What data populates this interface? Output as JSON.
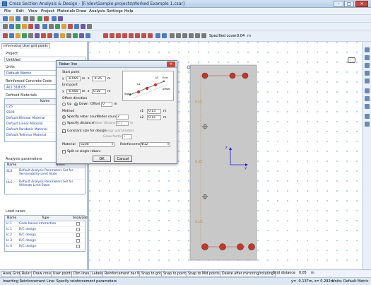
{
  "window": {
    "title": "Cross Section Analysis & Design - [F:\\dev\\Sample projects\\Worked Example 1.csar]",
    "colors": {
      "accent": "#3a7bd5",
      "rebar": "#c0392b",
      "section": "#c8c8c8",
      "grid_dot": "#3e8ed0"
    }
  },
  "menu": [
    "File",
    "Edit",
    "View",
    "Project",
    "Materials",
    "Draw",
    "Analysis",
    "Settings",
    "Help"
  ],
  "draw_toolbar": {
    "cover_label": "Specified cover:",
    "cover_value": "0.04",
    "cover_unit": "m"
  },
  "left_panel": {
    "tabs": [
      "Information",
      "User grid points"
    ],
    "project_label": "Project",
    "project_value": "Untitled",
    "units_label": "Units",
    "units_value": "Default Metric",
    "code_label": "Reinforced Concrete Code",
    "code_value": "ACI 318:05",
    "materials_label": "Defined Materials",
    "materials_header": "Name",
    "materials": [
      "C25",
      "S500",
      "Default Bilinear Material",
      "Default Linear Material",
      "Default Parabolic Material",
      "Default Tellinear Material"
    ],
    "analysis_label": "Analysis parameters",
    "analysis_headers": [
      "Name",
      "Notes"
    ],
    "analysis_rows": [
      {
        "name": "SLS",
        "notes": "Default Analysis Parameters Set for Serviceability Limit State"
      },
      {
        "name": "ULS",
        "notes": "Default Analysis Parameters Set for Ultimate Limit State"
      }
    ],
    "loads_label": "Load cases",
    "loads_headers": [
      "Name",
      "Type",
      "Analyzed"
    ],
    "loads": [
      {
        "name": "lc 1",
        "type": "Code based interaction"
      },
      {
        "name": "lc 1",
        "type": "R/C design"
      },
      {
        "name": "lc 2",
        "type": "R/C design"
      },
      {
        "name": "lc 3",
        "type": "R/C design"
      },
      {
        "name": "lc 4",
        "type": "R/C design"
      }
    ]
  },
  "dialog": {
    "title": "Rebar line",
    "start_point_label": "Start point",
    "start_y_label": "y",
    "start_y": "-0.085",
    "start_y_unit": "m",
    "start_z_label": "z",
    "start_z": "-0.26",
    "start_z_unit": "m",
    "end_point_label": "End point",
    "end_y_label": "y",
    "end_y": "-0.085",
    "end_y_unit": "m",
    "end_z_label": "z",
    "end_z": "0.26",
    "end_z_unit": "m",
    "offset_direction_label": "Offset direction",
    "up_label": "Up",
    "down_label": "Down",
    "offset_label": "Offset",
    "offset_value": "0",
    "offset_unit": "m",
    "method_label": "Method",
    "specify_count_label": "Specify rebar count",
    "rebar_count_label": "Rebar count",
    "rebar_count": "2",
    "specify_distance_label": "Specify distance",
    "rebar_distance_label": "Rebar distance",
    "rebar_distance": "0.1",
    "rebar_distance_unit": "m",
    "s1_label": "s1",
    "s1": "0.15",
    "s1_unit": "m",
    "s2_label": "s2",
    "s2": "0.15",
    "s2_unit": "m",
    "constant_size_label": "Constant size for design",
    "design_params_label": "Design parameters",
    "grow_factor_label": "Grow factor",
    "grow_factor": "1",
    "material_label": "Material",
    "material_value": "S500",
    "reinforcement_label": "Reinforcement",
    "reinforcement_value": "Φ12",
    "split_label": "Split to single rebars",
    "ok_label": "OK",
    "cancel_label": "Cancel",
    "diagram_labels": {
      "start": "Start",
      "end": "End",
      "s1": "s1",
      "s2": "s2",
      "offset": "offset"
    }
  },
  "canvas": {
    "dimension_labels": [
      "0.15",
      "0.22",
      "0.15"
    ],
    "axis_y": "y",
    "axis_z": "z"
  },
  "bottom_tabs": [
    "Axes",
    "Grid",
    "Ruler",
    "Draw cross",
    "User points",
    "Dim lines",
    "Labels",
    "Reinforcement bar Nr.",
    "Snap to grid",
    "Snap to points",
    "Snap to Mid points",
    "Delete after mirroring/rotating"
  ],
  "grid_distance": {
    "label": "Grid distance",
    "value": "0.05",
    "unit": "m"
  },
  "status": {
    "message": "Inserting Reinforcement Line: Specify reinforcement parameters",
    "coords": "y= -0.137m, z= 0.292m",
    "units": "Units: Default Metric"
  }
}
